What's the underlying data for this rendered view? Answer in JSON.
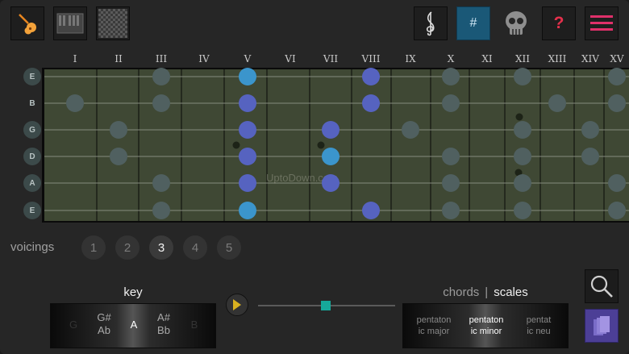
{
  "toolbar": {
    "left": [
      {
        "name": "guitar-icon"
      },
      {
        "name": "piano-icon"
      },
      {
        "name": "checker-icon"
      }
    ],
    "right": {
      "clef": {
        "name": "treble-clef-icon"
      },
      "sharp_label": "#",
      "skull": {
        "name": "skull-icon"
      },
      "help_label": "?",
      "menu": {
        "name": "hamburger-menu-icon"
      }
    }
  },
  "fretboard": {
    "fret_numbers": [
      "I",
      "II",
      "III",
      "IV",
      "V",
      "VI",
      "VII",
      "VIII",
      "IX",
      "X",
      "XI",
      "XII",
      "XIII",
      "XIV",
      "XV"
    ],
    "strings": [
      "E",
      "B",
      "G",
      "D",
      "A",
      "E"
    ],
    "watermark": "UptoDown.com",
    "dots": [
      {
        "string": 0,
        "fret": 3,
        "kind": "ghost"
      },
      {
        "string": 0,
        "fret": 5,
        "kind": "root"
      },
      {
        "string": 0,
        "fret": 8,
        "kind": "scale"
      },
      {
        "string": 0,
        "fret": 10,
        "kind": "ghost"
      },
      {
        "string": 0,
        "fret": 12,
        "kind": "ghost"
      },
      {
        "string": 0,
        "fret": 15,
        "kind": "ghost"
      },
      {
        "string": 1,
        "fret": 1,
        "kind": "ghost"
      },
      {
        "string": 1,
        "fret": 3,
        "kind": "ghost"
      },
      {
        "string": 1,
        "fret": 5,
        "kind": "scale"
      },
      {
        "string": 1,
        "fret": 8,
        "kind": "scale"
      },
      {
        "string": 1,
        "fret": 10,
        "kind": "ghost"
      },
      {
        "string": 1,
        "fret": 13,
        "kind": "ghost"
      },
      {
        "string": 1,
        "fret": 15,
        "kind": "ghost"
      },
      {
        "string": 2,
        "fret": 2,
        "kind": "ghost"
      },
      {
        "string": 2,
        "fret": 5,
        "kind": "scale"
      },
      {
        "string": 2,
        "fret": 7,
        "kind": "scale"
      },
      {
        "string": 2,
        "fret": 9,
        "kind": "ghost"
      },
      {
        "string": 2,
        "fret": 12,
        "kind": "ghost"
      },
      {
        "string": 2,
        "fret": 14,
        "kind": "ghost"
      },
      {
        "string": 3,
        "fret": 2,
        "kind": "ghost"
      },
      {
        "string": 3,
        "fret": 5,
        "kind": "scale"
      },
      {
        "string": 3,
        "fret": 7,
        "kind": "root"
      },
      {
        "string": 3,
        "fret": 10,
        "kind": "ghost"
      },
      {
        "string": 3,
        "fret": 12,
        "kind": "ghost"
      },
      {
        "string": 3,
        "fret": 14,
        "kind": "ghost"
      },
      {
        "string": 4,
        "fret": 3,
        "kind": "ghost"
      },
      {
        "string": 4,
        "fret": 5,
        "kind": "scale"
      },
      {
        "string": 4,
        "fret": 7,
        "kind": "scale"
      },
      {
        "string": 4,
        "fret": 10,
        "kind": "ghost"
      },
      {
        "string": 4,
        "fret": 12,
        "kind": "ghost"
      },
      {
        "string": 4,
        "fret": 15,
        "kind": "ghost"
      },
      {
        "string": 5,
        "fret": 3,
        "kind": "ghost"
      },
      {
        "string": 5,
        "fret": 5,
        "kind": "root"
      },
      {
        "string": 5,
        "fret": 8,
        "kind": "scale"
      },
      {
        "string": 5,
        "fret": 10,
        "kind": "ghost"
      },
      {
        "string": 5,
        "fret": 12,
        "kind": "ghost"
      },
      {
        "string": 5,
        "fret": 15,
        "kind": "ghost"
      }
    ]
  },
  "voicings": {
    "label": "voicings",
    "options": [
      "1",
      "2",
      "3",
      "4",
      "5"
    ],
    "selected": "3"
  },
  "key": {
    "title": "key",
    "items": [
      {
        "top": "",
        "bottom": "G",
        "state": "dim"
      },
      {
        "top": "G#",
        "bottom": "Ab",
        "state": "normal"
      },
      {
        "top": "",
        "bottom": "A",
        "state": "selected"
      },
      {
        "top": "A#",
        "bottom": "Bb",
        "state": "normal"
      },
      {
        "top": "",
        "bottom": "B",
        "state": "dim"
      }
    ]
  },
  "player": {
    "play_icon": "play-icon",
    "slider_value": 0.5
  },
  "mode": {
    "chords_label": "chords",
    "separator": "|",
    "scales_label": "scales",
    "selected": "scales",
    "scale_items": [
      {
        "line1": "pentaton",
        "line2": "ic major"
      },
      {
        "line1": "pentaton",
        "line2": "ic minor"
      },
      {
        "line1": "pentat",
        "line2": "ic neu"
      }
    ],
    "selected_scale": 1
  },
  "side": {
    "search": "magnifier-icon",
    "book": "book-icon"
  },
  "colors": {
    "board": "#3f4834",
    "ghost_dot": "#506060",
    "scale_dot": "#5663c0",
    "root_dot": "#3b95cc",
    "active_button": "#1a5877",
    "help": "#e5304c",
    "menu": "#e0306a",
    "slider_thumb": "#16a89a",
    "book_button": "#4c3f96"
  }
}
